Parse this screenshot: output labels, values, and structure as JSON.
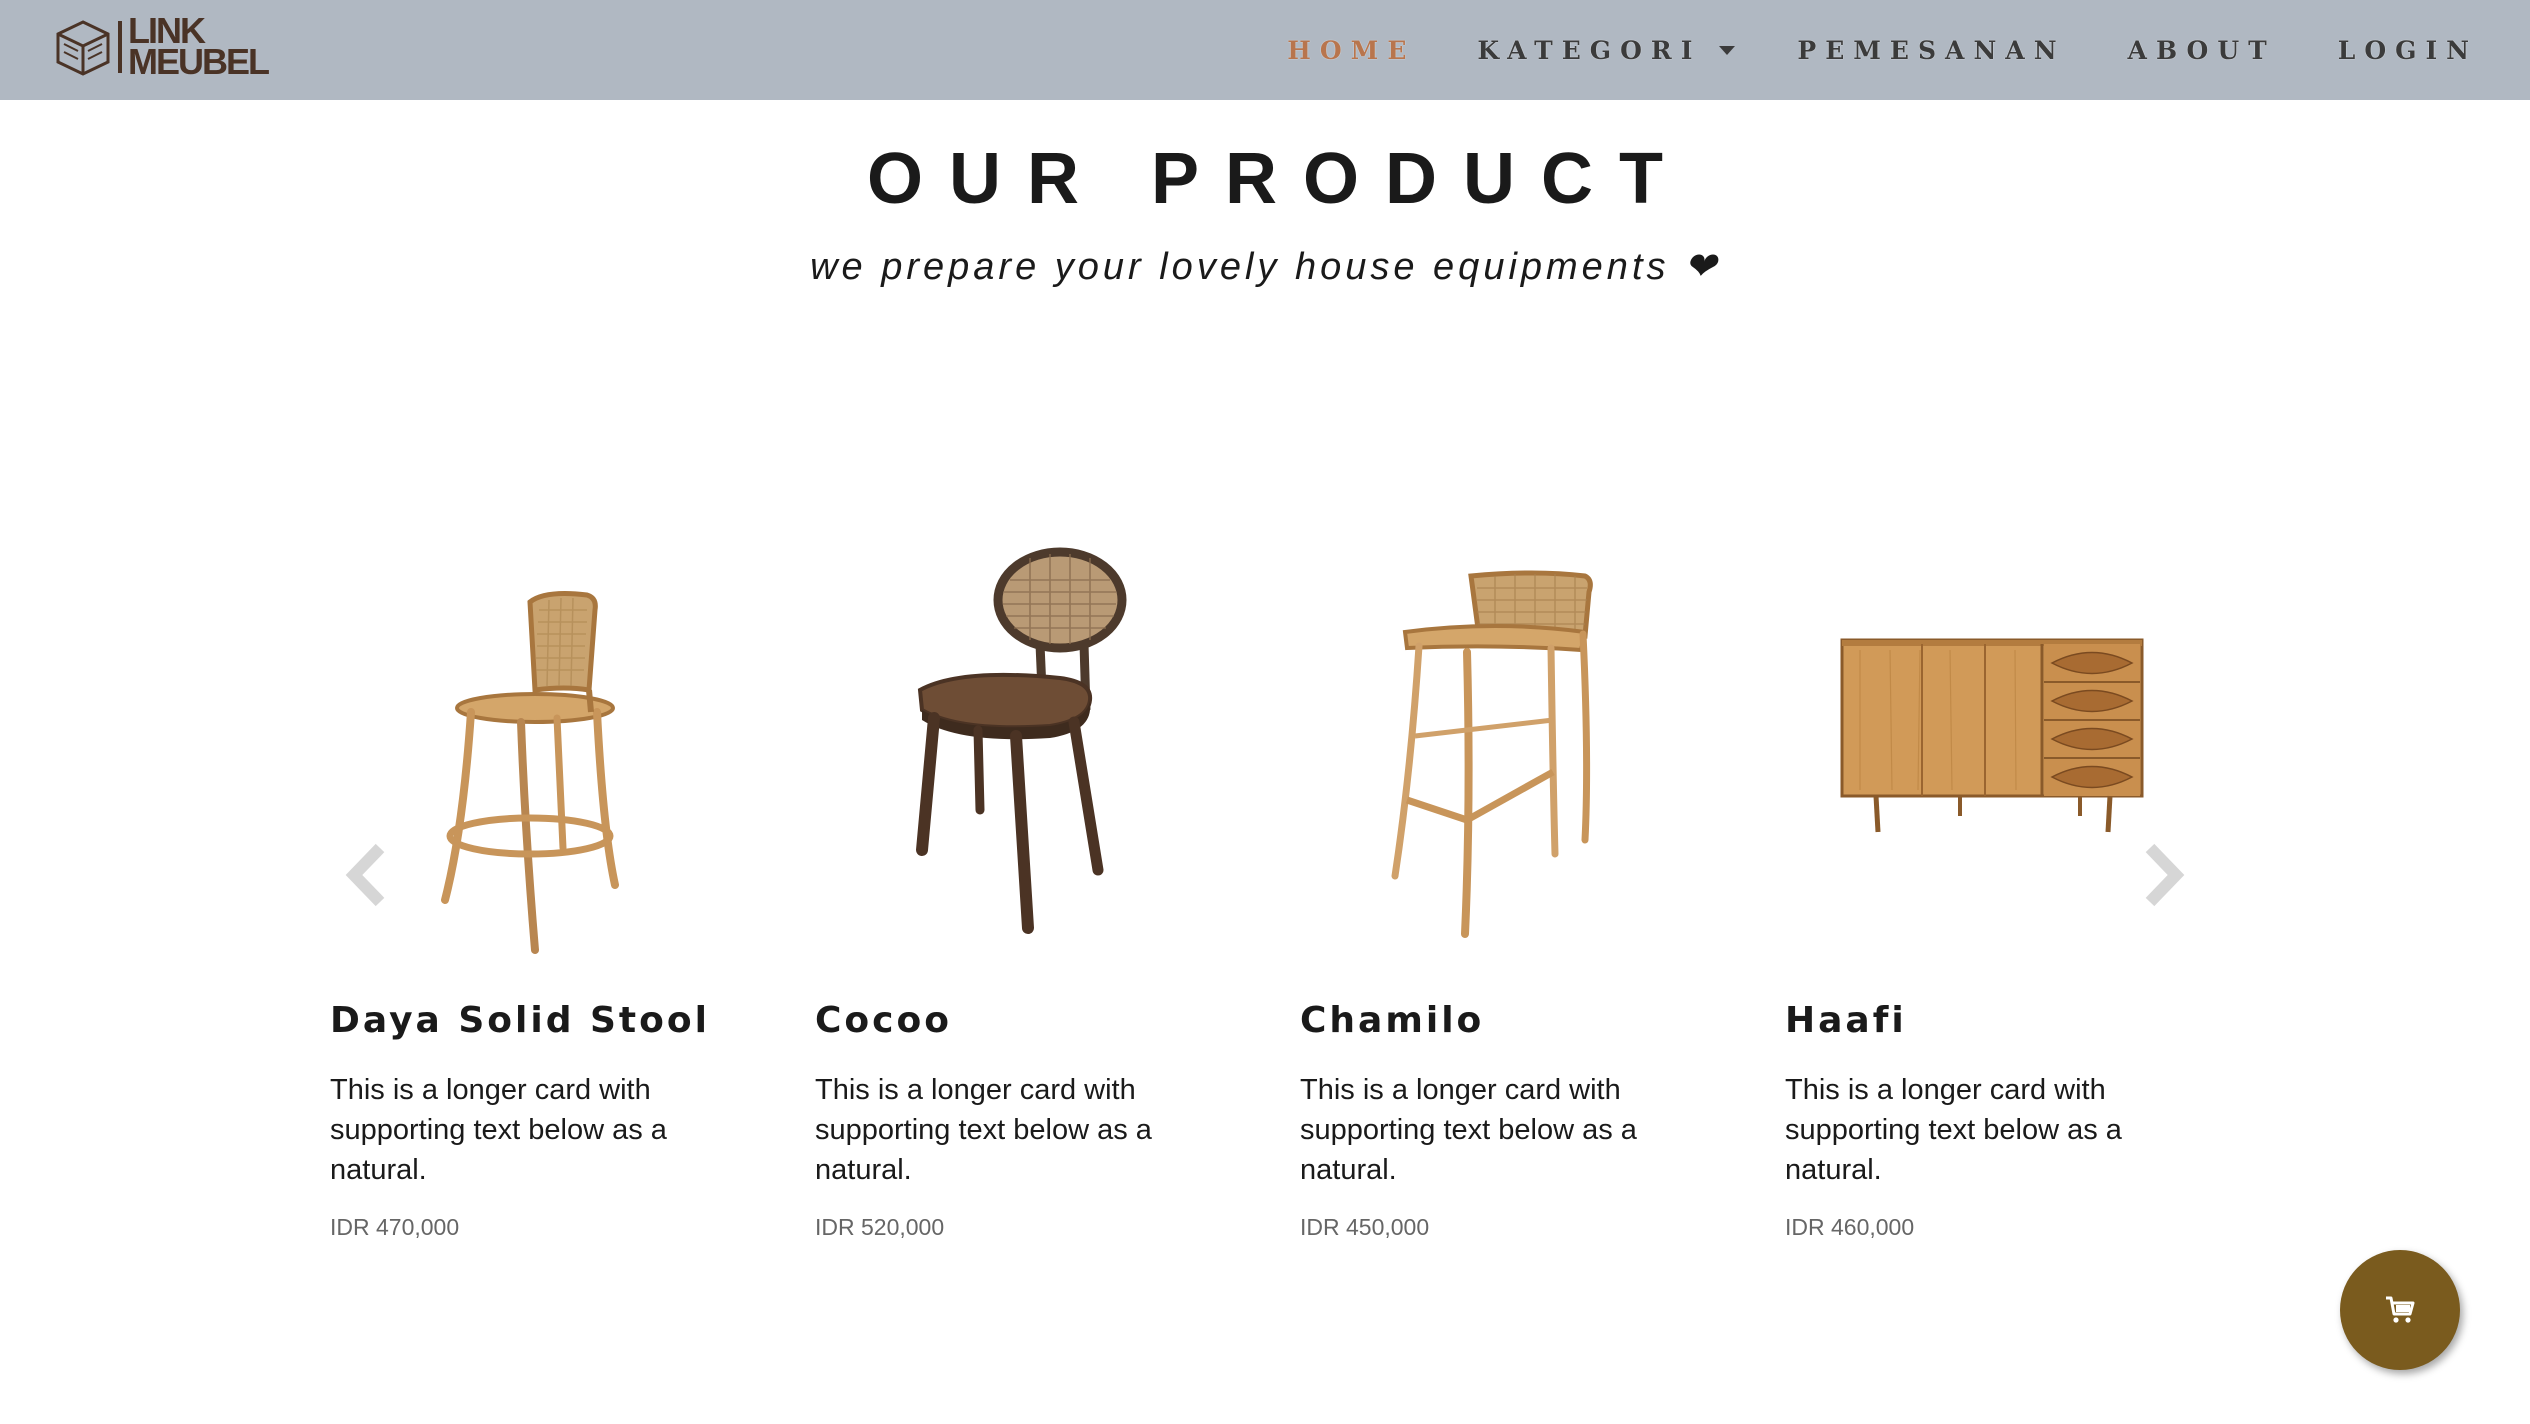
{
  "brand": {
    "line1": "LINK",
    "line2": "MEUBEL",
    "logo_icon": "box-logo-icon",
    "logo_color": "#4a3326"
  },
  "nav": {
    "background": "#b0b8c2",
    "active_color": "#b8754d",
    "items": [
      {
        "label": "HOME",
        "active": true
      },
      {
        "label": "KATEGORI",
        "dropdown": true
      },
      {
        "label": "PEMESANAN"
      },
      {
        "label": "ABOUT"
      },
      {
        "label": "LOGIN"
      }
    ]
  },
  "hero": {
    "title": "OUR PRODUCT",
    "subtitle": "we prepare your lovely house equipments ❤"
  },
  "carousel": {
    "prev_icon": "chevron-left-icon",
    "next_icon": "chevron-right-icon",
    "products": [
      {
        "name": "Daya Solid Stool",
        "description": "This is a longer card with supporting text below as a natural.",
        "price": "IDR 470,000",
        "image": "bar-stool-rattan"
      },
      {
        "name": "Cocoo",
        "description": "This is a longer card with supporting text below as a natural.",
        "price": "IDR 520,000",
        "image": "dining-chair-dark"
      },
      {
        "name": "Chamilo",
        "description": "This is a longer card with supporting text below as a natural.",
        "price": "IDR 450,000",
        "image": "bar-stool-tall"
      },
      {
        "name": "Haafi",
        "description": "This is a longer card with supporting text below as a natural.",
        "price": "IDR 460,000",
        "image": "sideboard-cabinet"
      }
    ]
  },
  "cart": {
    "icon": "cart-icon",
    "color": "#7a5b1e"
  }
}
